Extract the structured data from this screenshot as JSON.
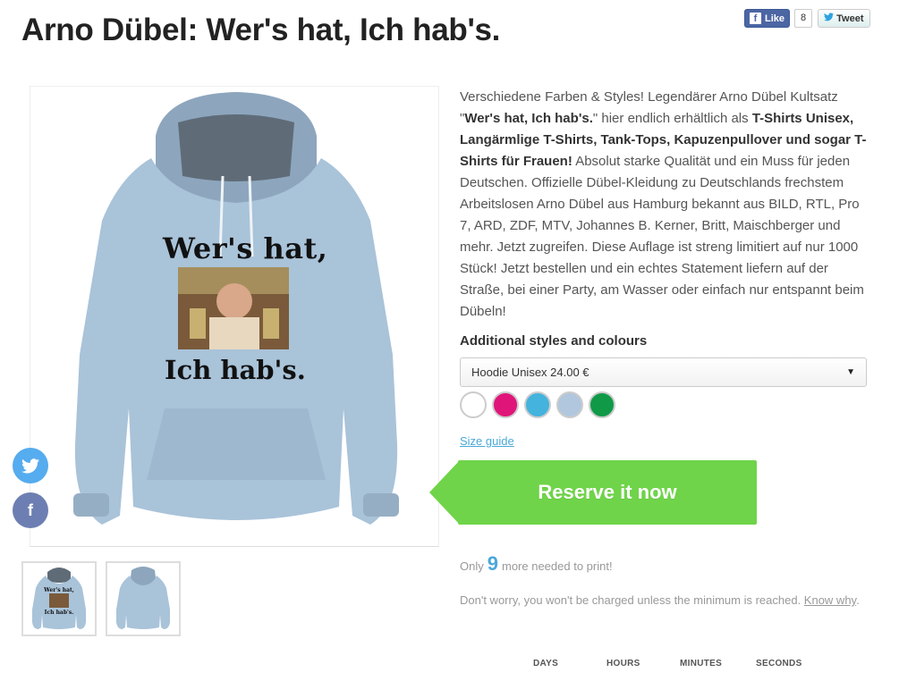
{
  "page": {
    "title": "Arno Dübel: Wer's hat, Ich hab's."
  },
  "social_top": {
    "like_label": "Like",
    "like_count": "8",
    "tweet_label": "Tweet"
  },
  "product_image": {
    "print_line1": "Wer's hat,",
    "print_line2": "Ich hab's.",
    "garment_color": "#a9c3d9"
  },
  "description": {
    "p1": "Verschiedene Farben & Styles! Legendärer Arno Dübel Kultsatz \"",
    "b1": "Wer's hat, Ich hab's.",
    "p2": "\" hier endlich erhältlich als ",
    "b2": "T-Shirts Unisex, Langärmlige T-Shirts, Tank-Tops, Kapuzenpullover und sogar T-Shirts für Frauen!",
    "p3": " Absolut starke Qualität und ein Muss für jeden Deutschen. Offizielle Dübel-Kleidung zu Deutschlands frechstem Arbeitslosen Arno Dübel aus Hamburg bekannt aus BILD, RTL, Pro 7, ARD, ZDF, MTV, Johannes B. Kerner, Britt, Maischberger und mehr. Jetzt zugreifen. Diese Auflage ist streng limitiert auf nur 1000 Stück! Jetzt bestellen und ein echtes Statement liefern auf der Straße, bei einer Party, am Wasser oder einfach nur entspannt beim Dübeln!"
  },
  "styles": {
    "label": "Additional styles and colours",
    "selected": "Hoodie Unisex 24.00 €",
    "swatch_colors": [
      "#ffffff",
      "#e0157a",
      "#44b3de",
      "#b1c7de",
      "#109a48"
    ]
  },
  "size_guide": "Size guide",
  "reserve_button": "Reserve it now",
  "progress": {
    "prefix": "Only",
    "count": "9",
    "suffix": "more needed to print!"
  },
  "notice": {
    "text": "Don't worry, you won't be charged unless the minimum is reached. ",
    "link": "Know why",
    "end": "."
  },
  "countdown": {
    "days": "DAYS",
    "hours": "HOURS",
    "minutes": "MINUTES",
    "seconds": "SECONDS"
  },
  "colors": {
    "accent_green": "#6fd449",
    "link_blue": "#4aa8d8",
    "twitter": "#55acee",
    "facebook": "#6d7fb2"
  }
}
